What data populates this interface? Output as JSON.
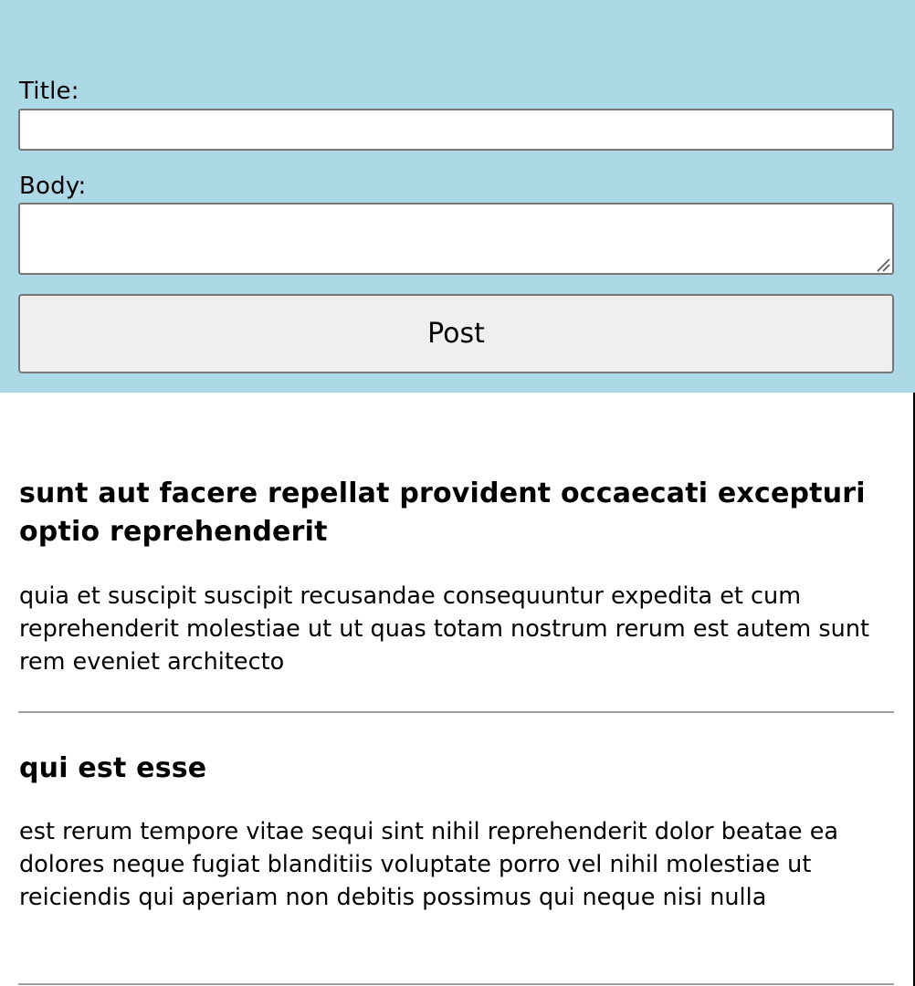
{
  "form": {
    "title_label": "Title:",
    "title_value": "",
    "body_label": "Body:",
    "body_value": "",
    "post_button_label": "Post",
    "panel_color": "#add8e6"
  },
  "posts": [
    {
      "title": "sunt aut facere repellat provident occaecati excepturi optio reprehenderit",
      "body": "quia et suscipit suscipit recusandae consequuntur expedita et cum reprehenderit molestiae ut ut quas totam nostrum rerum est autem sunt rem eveniet architecto"
    },
    {
      "title": "qui est esse",
      "body": "est rerum tempore vitae sequi sint nihil reprehenderit dolor beatae ea dolores neque fugiat blanditiis voluptate porro vel nihil molestiae ut reiciendis qui aperiam non debitis possimus qui neque nisi nulla"
    }
  ]
}
